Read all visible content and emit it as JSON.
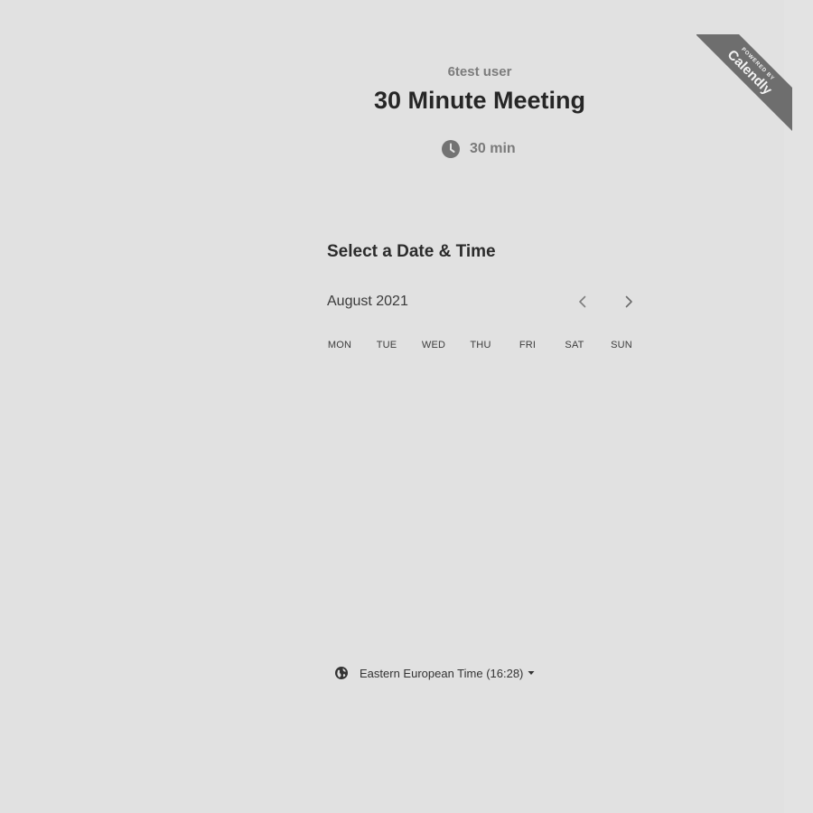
{
  "header": {
    "owner_name": "6test user",
    "event_title": "30 Minute Meeting",
    "duration": "30 min",
    "duration_icon": "clock-icon"
  },
  "calendar": {
    "heading": "Select a Date & Time",
    "month_label": "August 2021",
    "prev_icon": "chevron-left-icon",
    "next_icon": "chevron-right-icon",
    "weekdays": [
      "MON",
      "TUE",
      "WED",
      "THU",
      "FRI",
      "SAT",
      "SUN"
    ]
  },
  "timezone": {
    "label": "Eastern European Time (16:28)",
    "icon": "globe-icon",
    "caret_icon": "caret-down-icon"
  },
  "badge": {
    "small_text": "POWERED BY",
    "brand_text": "Calendly"
  },
  "colors": {
    "background": "#e1e1e1",
    "ribbon": "#6e6e6e",
    "title": "#262626",
    "muted": "#7a7a7a"
  }
}
